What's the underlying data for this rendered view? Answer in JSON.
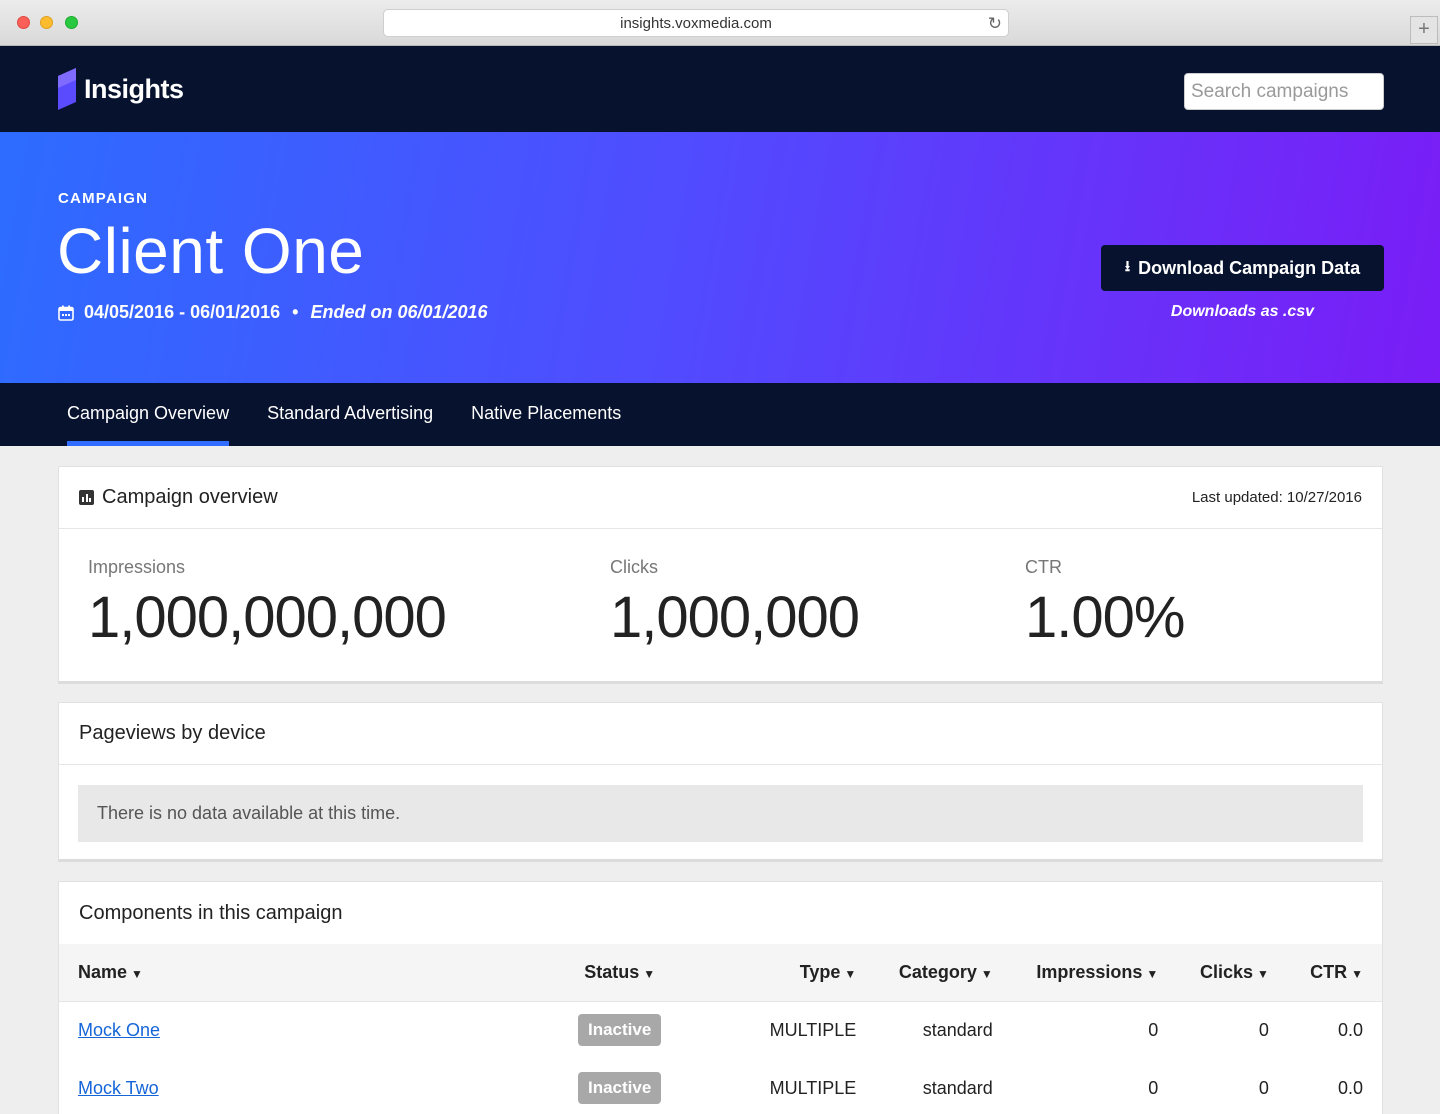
{
  "browser": {
    "url": "insights.voxmedia.com",
    "reload_icon": "reload-icon",
    "new_tab_label": "+"
  },
  "header": {
    "logo_text": "Insights",
    "search_placeholder": "Search campaigns"
  },
  "hero": {
    "kicker": "CAMPAIGN",
    "title": "Client One",
    "date_range": "04/05/2016 - 06/01/2016",
    "separator": "•",
    "ended": "Ended on 06/01/2016",
    "download_label": "Download Campaign Data",
    "download_note": "Downloads as .csv",
    "colors": {
      "gradient_start": "#2d6cff",
      "gradient_end": "#7a1df6",
      "dark": "#07122e"
    }
  },
  "tabs": [
    {
      "label": "Campaign Overview",
      "active": true
    },
    {
      "label": "Standard Advertising",
      "active": false
    },
    {
      "label": "Native Placements",
      "active": false
    }
  ],
  "overview": {
    "title": "Campaign overview",
    "last_updated": "Last updated: 10/27/2016",
    "stats": [
      {
        "label": "Impressions",
        "value": "1,000,000,000"
      },
      {
        "label": "Clicks",
        "value": "1,000,000"
      },
      {
        "label": "CTR",
        "value": "1.00%"
      }
    ]
  },
  "pageviews": {
    "title": "Pageviews by device",
    "empty_message": "There is no data available at this time."
  },
  "components": {
    "title": "Components in this campaign",
    "columns": [
      "Name",
      "Status",
      "Type",
      "Category",
      "Impressions",
      "Clicks",
      "CTR"
    ],
    "rows": [
      {
        "name": "Mock One",
        "status": "Inactive",
        "type": "MULTIPLE",
        "category": "standard",
        "impressions": "0",
        "clicks": "0",
        "ctr": "0.0"
      },
      {
        "name": "Mock Two",
        "status": "Inactive",
        "type": "MULTIPLE",
        "category": "standard",
        "impressions": "0",
        "clicks": "0",
        "ctr": "0.0"
      }
    ]
  }
}
